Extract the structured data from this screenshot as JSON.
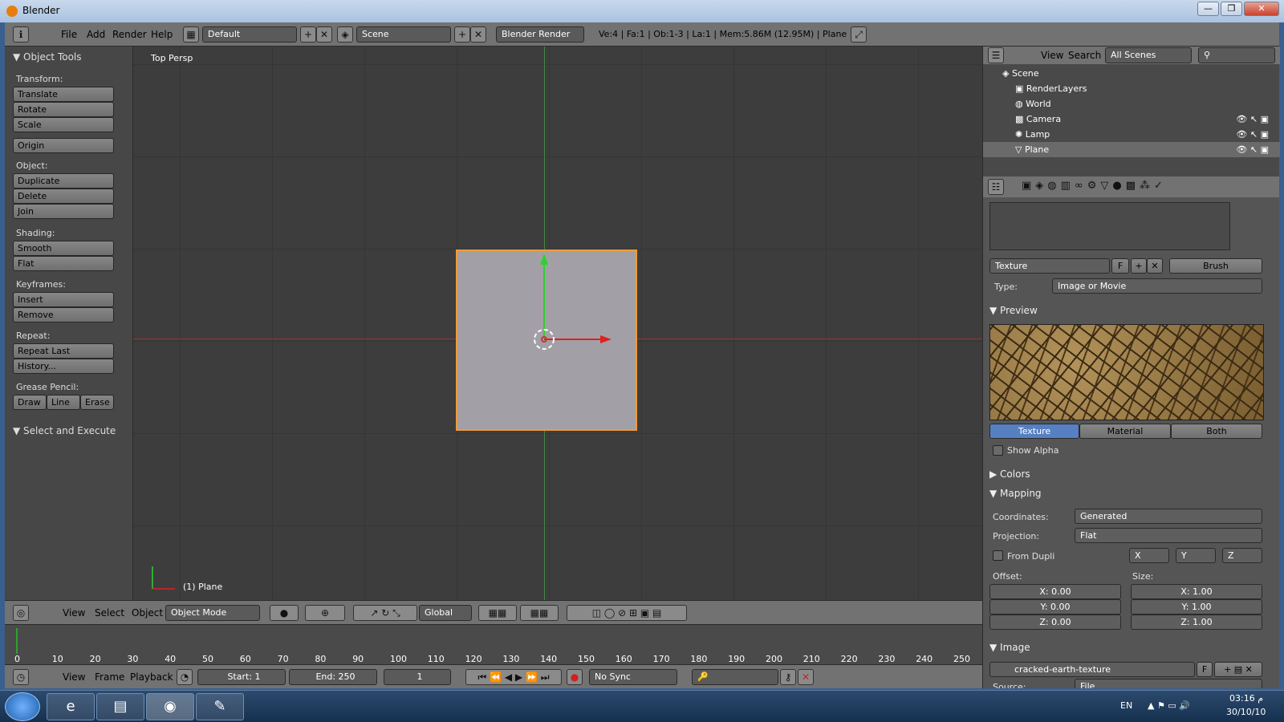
{
  "window": {
    "title": "Blender",
    "controls": [
      "—",
      "❐",
      "✕"
    ]
  },
  "topbar": {
    "menus": [
      "File",
      "Add",
      "Render",
      "Help"
    ],
    "layout": "Default",
    "scene": "Scene",
    "engine": "Blender Render",
    "stats": "Ve:4 | Fa:1 | Ob:1-3 | La:1 | Mem:5.86M (12.95M) | Plane"
  },
  "toolshelf": {
    "title": "Object Tools",
    "transform_label": "Transform:",
    "translate": "Translate",
    "rotate": "Rotate",
    "scale": "Scale",
    "origin": "Origin",
    "object_label": "Object:",
    "duplicate": "Duplicate",
    "delete": "Delete",
    "join": "Join",
    "shading_label": "Shading:",
    "smooth": "Smooth",
    "flat": "Flat",
    "keyframes_label": "Keyframes:",
    "insert": "Insert",
    "remove": "Remove",
    "repeat_label": "Repeat:",
    "repeat_last": "Repeat Last",
    "history": "History...",
    "grease_label": "Grease Pencil:",
    "draw": "Draw",
    "line": "Line",
    "erase": "Erase",
    "select_execute": "Select and Execute"
  },
  "viewport": {
    "view_name": "Top Persp",
    "object_label": "(1) Plane",
    "header": {
      "view": "View",
      "select": "Select",
      "object": "Object",
      "mode": "Object Mode",
      "orientation": "Global"
    }
  },
  "timeline": {
    "ticks": [
      "0",
      "10",
      "20",
      "30",
      "40",
      "50",
      "60",
      "70",
      "80",
      "90",
      "100",
      "110",
      "120",
      "130",
      "140",
      "150",
      "160",
      "170",
      "180",
      "190",
      "200",
      "210",
      "220",
      "230",
      "240",
      "250"
    ],
    "header": {
      "view": "View",
      "frame": "Frame",
      "playback": "Playback",
      "start": "Start: 1",
      "end": "End: 250",
      "current": "1",
      "sync": "No Sync"
    }
  },
  "outliner": {
    "view": "View",
    "search": "Search",
    "filter": "All Scenes",
    "rows": [
      "Scene",
      "RenderLayers",
      "World",
      "Camera",
      "Lamp",
      "Plane"
    ]
  },
  "properties": {
    "texture_name": "Texture",
    "fake_user": "F",
    "brush": "Brush",
    "type_label": "Type:",
    "type_value": "Image or Movie",
    "preview_label": "Preview",
    "preview_tabs": [
      "Texture",
      "Material",
      "Both"
    ],
    "show_alpha": "Show Alpha",
    "colors_label": "Colors",
    "mapping_label": "Mapping",
    "coordinates_label": "Coordinates:",
    "coordinates_value": "Generated",
    "projection_label": "Projection:",
    "projection_value": "Flat",
    "from_dupli": "From Dupli",
    "axes": [
      "X",
      "Y",
      "Z"
    ],
    "offset_label": "Offset:",
    "size_label": "Size:",
    "offset": [
      "X: 0.00",
      "Y: 0.00",
      "Z: 0.00"
    ],
    "size": [
      "X: 1.00",
      "Y: 1.00",
      "Z: 1.00"
    ],
    "image_label": "Image",
    "image_name": "cracked-earth-texture",
    "source_label": "Source:",
    "source_value": "File"
  },
  "taskbar": {
    "lang": "EN",
    "time": "03:16 م",
    "date": "30/10/10"
  }
}
